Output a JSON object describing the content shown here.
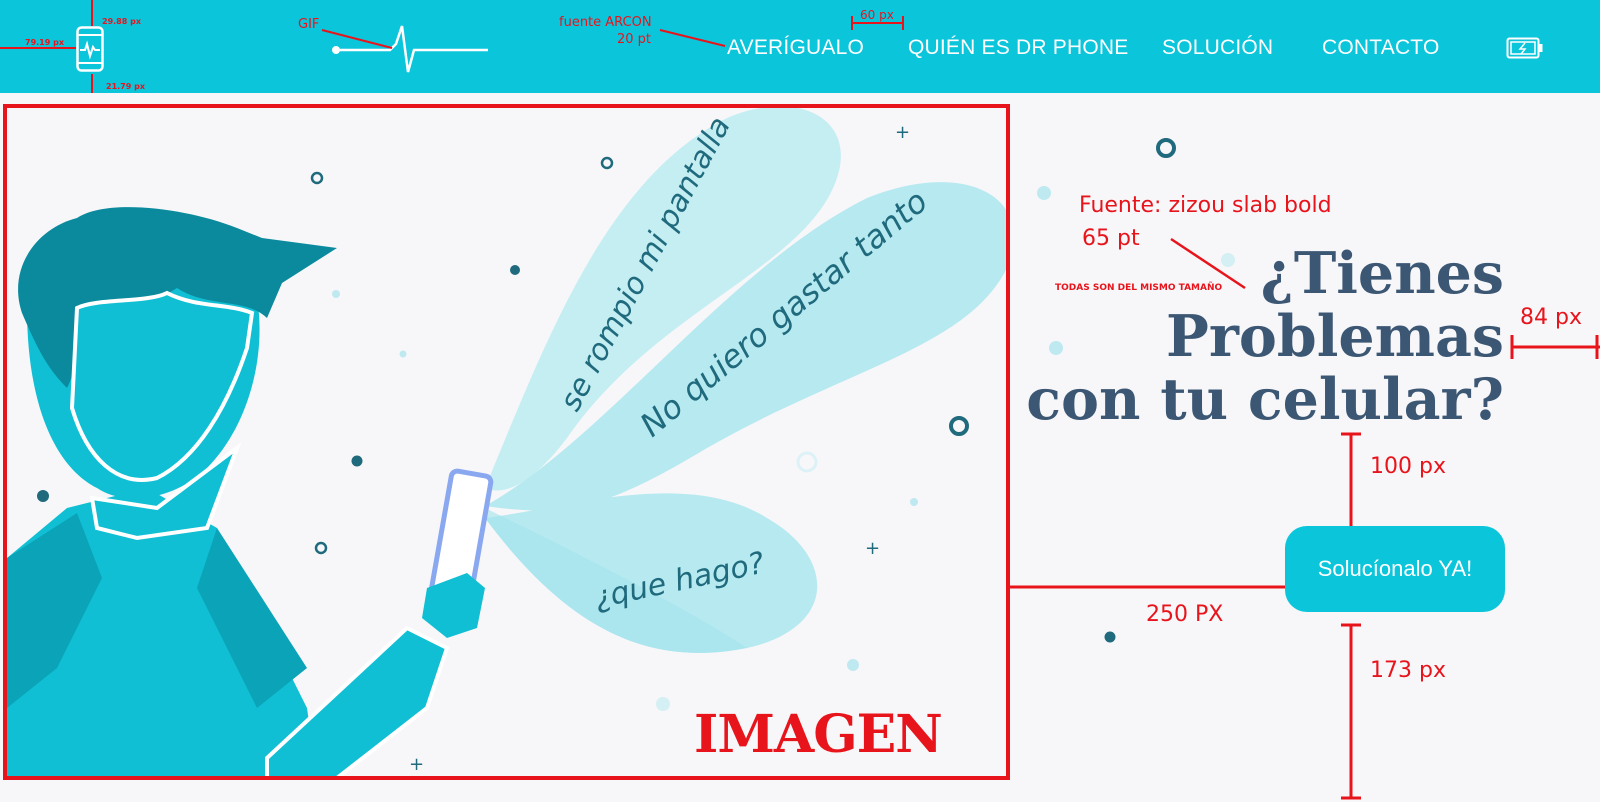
{
  "nav": {
    "items": [
      "AVERÍGUALO",
      "QUIÉN ES DR PHONE",
      "SOLUCIÓN",
      "CONTACTO"
    ],
    "icons": {
      "logo": "phone-heartbeat-icon",
      "pulse": "heartbeat-line-icon",
      "battery": "battery-charging-icon"
    }
  },
  "annotations": {
    "logo_width": "79.19 px",
    "logo_height": "29.88 px",
    "logo_bottom": "21.79 px",
    "gif": "GIF",
    "nav_font": "fuente ARCON",
    "nav_size": "20 pt",
    "nav_gap": "60 px",
    "headline_font": "Fuente: zizou slab bold",
    "headline_size": "65 pt",
    "same_size": "TODAS SON DEL MISMO TAMAÑO",
    "right_margin": "84 px",
    "gap_above_button": "100 px",
    "gap_left_button": "250 PX",
    "gap_below_button": "173 px",
    "image_label": "IMAGEN"
  },
  "illustration": {
    "bubbles": [
      "se rompio mi pantalla",
      "No quiero gastar tanto",
      "¿que hago?"
    ]
  },
  "hero": {
    "headline": [
      "¿Tienes",
      "Problemas",
      "con tu celular?"
    ],
    "cta": "Solucíonalo YA!"
  },
  "colors": {
    "accent": "#0bc5db",
    "headline": "#3c5774",
    "annotation": "#e8141c",
    "background": "#f7f7f9"
  }
}
